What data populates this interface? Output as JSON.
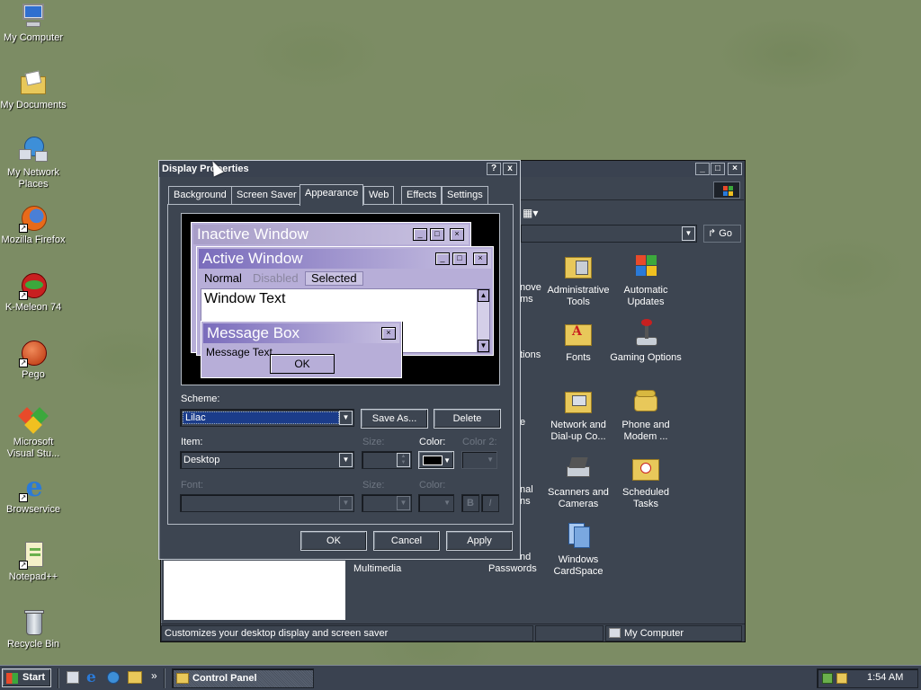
{
  "desktop": {
    "icons": [
      {
        "label": "My Computer"
      },
      {
        "label": "My Documents"
      },
      {
        "label": "My Network Places"
      },
      {
        "label": "Mozilla Firefox"
      },
      {
        "label": "K-Meleon 74"
      },
      {
        "label": "Pego"
      },
      {
        "label": "Microsoft Visual Stu..."
      },
      {
        "label": "Browservice"
      },
      {
        "label": "Notepad++"
      },
      {
        "label": "Recycle Bin"
      }
    ]
  },
  "control_panel": {
    "go_label": "Go",
    "icons": [
      {
        "label": "Administrative Tools"
      },
      {
        "label": "Automatic Updates"
      },
      {
        "label": "Fonts"
      },
      {
        "label": "Gaming Options"
      },
      {
        "label": "Network and Dial-up Co..."
      },
      {
        "label": "Phone and Modem ..."
      },
      {
        "label": "Scanners and Cameras"
      },
      {
        "label": "Scheduled Tasks"
      },
      {
        "label": "Windows CardSpace"
      }
    ],
    "partial_labels": [
      "nove",
      "ms",
      "tions",
      "e",
      "nal",
      "ns",
      "nd",
      "Passwords",
      "Multimedia"
    ],
    "status_left": "Customizes your desktop display and screen saver",
    "status_right": "My Computer"
  },
  "dialog": {
    "title": "Display Properties",
    "help_btn": "?",
    "close_btn": "x",
    "tabs": [
      "Background",
      "Screen Saver",
      "Appearance",
      "Web",
      "Effects",
      "Settings"
    ],
    "selected_tab": "Appearance",
    "preview": {
      "inactive_title": "Inactive Window",
      "active_title": "Active Window",
      "menu_normal": "Normal",
      "menu_disabled": "Disabled",
      "menu_selected": "Selected",
      "window_text": "Window Text",
      "msgbox_title": "Message Box",
      "msgbox_text": "Message Text",
      "msgbox_ok": "OK"
    },
    "scheme_label": "Scheme:",
    "scheme_value": "Lilac",
    "save_as": "Save As...",
    "delete": "Delete",
    "item_label": "Item:",
    "item_value": "Desktop",
    "size_label": "Size:",
    "color_label": "Color:",
    "color2_label": "Color 2:",
    "font_label": "Font:",
    "bold_btn": "B",
    "italic_btn": "I",
    "ok": "OK",
    "cancel": "Cancel",
    "apply": "Apply"
  },
  "taskbar": {
    "start": "Start",
    "active_task": "Control Panel",
    "overflow": "»",
    "clock": "1:54 AM"
  },
  "colors": {
    "desktop": "#7c8c64",
    "window": "#3d4551",
    "lilac_title": "#8f82c8",
    "lilac_face": "#b7aed8",
    "selection": "#1b3c8a"
  }
}
